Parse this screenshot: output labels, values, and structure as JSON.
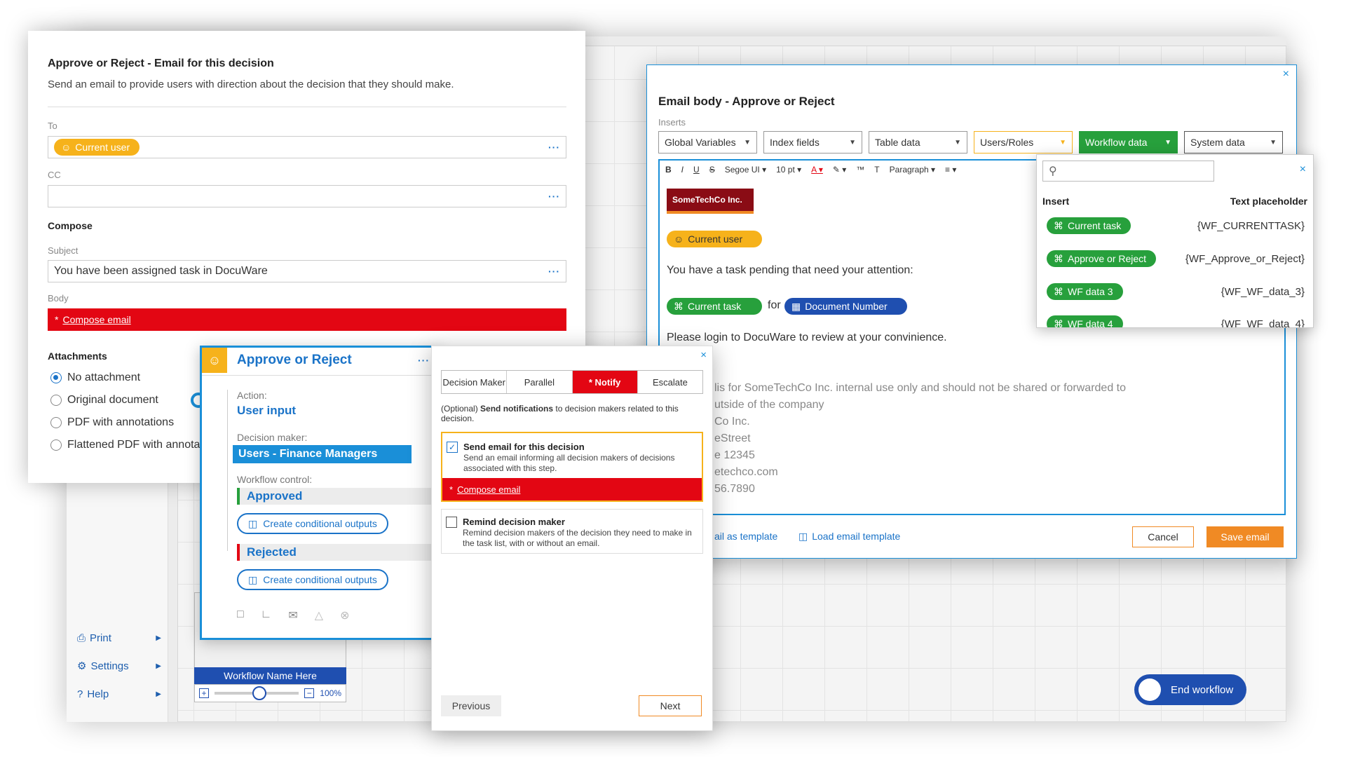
{
  "canvas": {
    "nav": [
      {
        "label": "Print",
        "icon": "print-icon"
      },
      {
        "label": "Settings",
        "icon": "gear-icon"
      },
      {
        "label": "Help",
        "icon": "help-icon"
      }
    ]
  },
  "minimap": {
    "title": "Workflow Name Here",
    "zoom": "100%",
    "zoom_fraction": 0.45
  },
  "end_workflow": {
    "label": "End workflow"
  },
  "email_decision": {
    "title": "Approve or Reject - Email for this decision",
    "subtitle": "Send an email to provide users with direction about the decision that they should make.",
    "to_label": "To",
    "to_pill": "Current user",
    "cc_label": "CC",
    "compose_heading": "Compose",
    "subject_label": "Subject",
    "subject_value": "You have been assigned task in DocuWare",
    "body_label": "Body",
    "body_required": "*",
    "body_link": "Compose email",
    "attachments_heading": "Attachments",
    "attachment_options": [
      "No attachment",
      "Original document",
      "PDF with annotations",
      "Flattened PDF with annotations"
    ],
    "attachment_selected": "No attachment"
  },
  "decision_card": {
    "title": "Approve or Reject",
    "action_label": "Action:",
    "action_value": "User input",
    "decision_maker_label": "Decision maker:",
    "decision_maker_value": "Users - Finance Managers",
    "workflow_control_label": "Workflow control:",
    "approved": "Approved",
    "rejected": "Rejected",
    "conditional_button": "Create conditional outputs"
  },
  "notify_dialog": {
    "steps": [
      "Decision Maker",
      "Parallel",
      "* Notify",
      "Escalate"
    ],
    "active_step": "* Notify",
    "intro_prefix": "(Optional) ",
    "intro_bold": "Send notifications",
    "intro_suffix": " to decision makers related to this decision.",
    "opt1_title": "Send email for this decision",
    "opt1_desc": "Send an email informing all decision makers of decisions associated with this step.",
    "opt1_checked": true,
    "opt1_link": "Compose email",
    "opt2_title": "Remind decision maker",
    "opt2_desc": "Remind decision makers of the decision they need to make in the task list, with or without an email.",
    "opt2_checked": false,
    "previous": "Previous",
    "next": "Next"
  },
  "email_body": {
    "title": "Email body - Approve or Reject",
    "inserts_label": "Inserts",
    "dropdowns": [
      "Global Variables",
      "Index fields",
      "Table data",
      "Users/Roles",
      "Workflow data",
      "System data"
    ],
    "active_dropdown": "Workflow data",
    "toolbar": {
      "font": "Segoe UI",
      "size": "10 pt",
      "paragraph": "Paragraph"
    },
    "logo_text": "SomeTechCo Inc.",
    "pill_current_user": "Current user",
    "line1": "You have a task pending that need your attention:",
    "pill_current_task": "Current task",
    "for_word": "for",
    "pill_document_number": "Document Number",
    "line2": "Please login to DocuWare to review at your convinience.",
    "footer_lines": [
      "lis for SomeTechCo Inc. internal use only and should not be shared or forwarded to",
      "utside of the company",
      "Co Inc.",
      "eStreet",
      "e 12345",
      "etechco.com",
      "56.7890"
    ],
    "save_template": "ail as template",
    "load_template": "Load email template",
    "cancel": "Cancel",
    "save": "Save email"
  },
  "insert_popup": {
    "col_insert": "Insert",
    "col_placeholder": "Text placeholder",
    "rows": [
      {
        "insert": "Current task",
        "placeholder": "{WF_CURRENTTASK}"
      },
      {
        "insert": "Approve or Reject",
        "placeholder": "{WF_Approve_or_Reject}"
      },
      {
        "insert": "WF data 3",
        "placeholder": "{WF_WF_data_3}"
      },
      {
        "insert": "WF data 4",
        "placeholder": "{WF_WF_data_4}"
      }
    ]
  },
  "colors": {
    "accent_blue": "#1a73c8",
    "required_red": "#e30613",
    "orange": "#f6b21b",
    "green": "#27a03c",
    "save_orange": "#f08a24"
  }
}
